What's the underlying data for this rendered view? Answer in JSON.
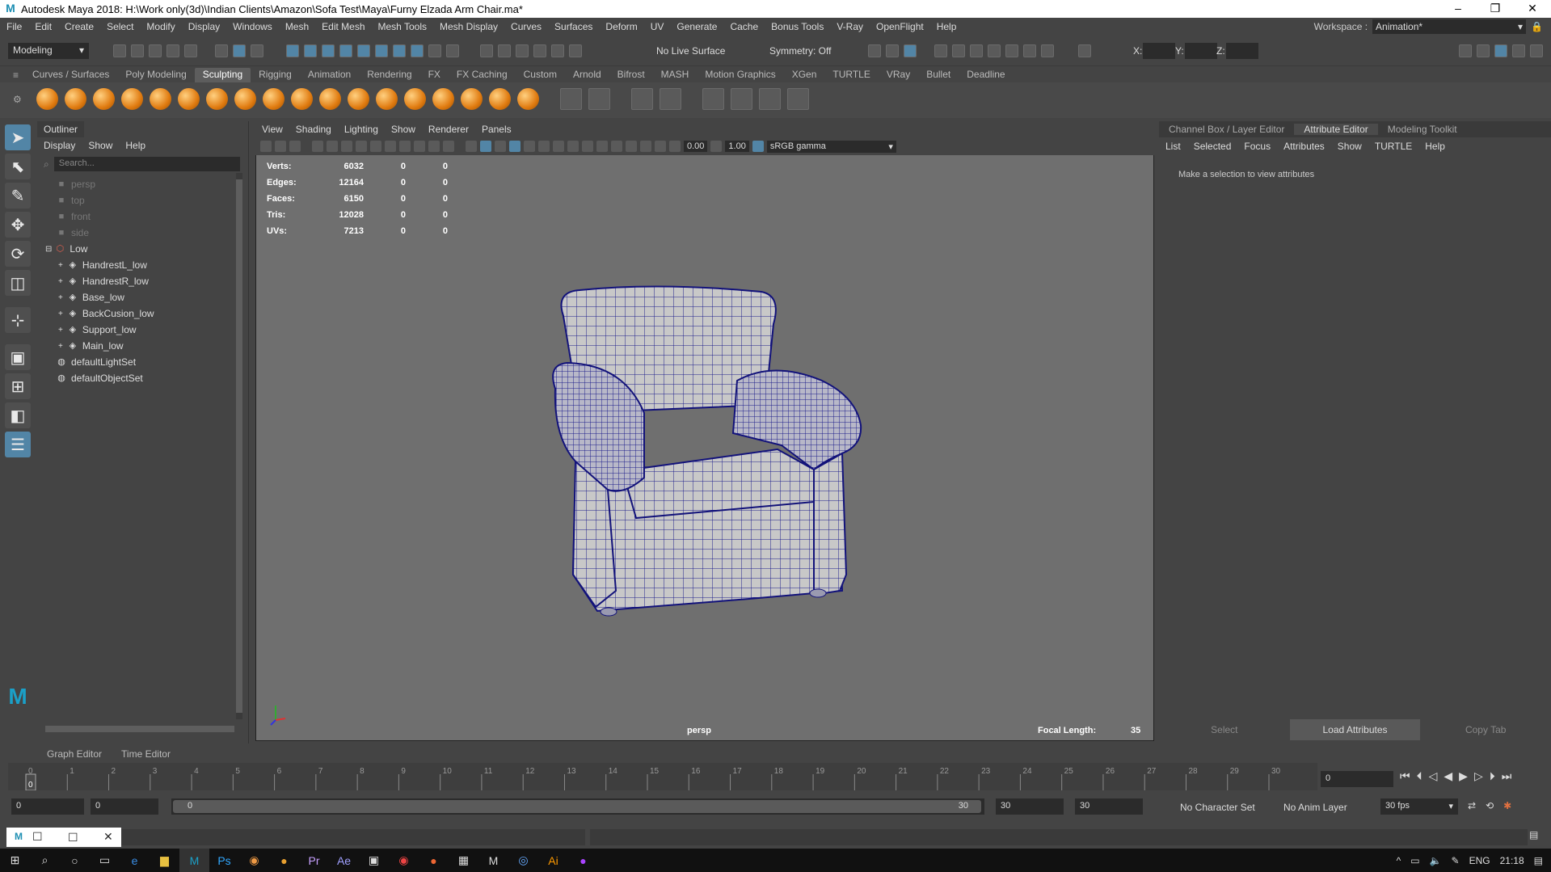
{
  "window": {
    "title": "Autodesk Maya 2018: H:\\Work only(3d)\\Indian Clients\\Amazon\\Sofa Test\\Maya\\Furny Elzada Arm Chair.ma*",
    "logo": "M"
  },
  "menu": [
    "File",
    "Edit",
    "Create",
    "Select",
    "Modify",
    "Display",
    "Windows",
    "Mesh",
    "Edit Mesh",
    "Mesh Tools",
    "Mesh Display",
    "Curves",
    "Surfaces",
    "Deform",
    "UV",
    "Generate",
    "Cache",
    "Bonus Tools",
    "V-Ray",
    "OpenFlight",
    "Help"
  ],
  "workspace": {
    "label": "Workspace :",
    "value": "Animation*"
  },
  "status": {
    "mode": "Modeling",
    "live_surface": "No Live Surface",
    "symmetry": "Symmetry: Off",
    "x_label": "X:",
    "y_label": "Y:",
    "z_label": "Z:"
  },
  "shelf_tabs": [
    "Curves / Surfaces",
    "Poly Modeling",
    "Sculpting",
    "Rigging",
    "Animation",
    "Rendering",
    "FX",
    "FX Caching",
    "Custom",
    "Arnold",
    "Bifrost",
    "MASH",
    "Motion Graphics",
    "XGen",
    "TURTLE",
    "VRay",
    "Bullet",
    "Deadline"
  ],
  "shelf_active": "Sculpting",
  "outliner": {
    "title": "Outliner",
    "menu": [
      "Display",
      "Show",
      "Help"
    ],
    "search_placeholder": "Search...",
    "items": [
      {
        "label": "persp",
        "dim": true,
        "indent": 0,
        "icon": "camera-icon"
      },
      {
        "label": "top",
        "dim": true,
        "indent": 0,
        "icon": "camera-icon"
      },
      {
        "label": "front",
        "dim": true,
        "indent": 0,
        "icon": "camera-icon"
      },
      {
        "label": "side",
        "dim": true,
        "indent": 0,
        "icon": "camera-icon"
      },
      {
        "label": "Low",
        "dim": false,
        "indent": 0,
        "icon": "group-icon"
      },
      {
        "label": "HandrestL_low",
        "dim": false,
        "indent": 1,
        "icon": "mesh-icon"
      },
      {
        "label": "HandrestR_low",
        "dim": false,
        "indent": 1,
        "icon": "mesh-icon"
      },
      {
        "label": "Base_low",
        "dim": false,
        "indent": 1,
        "icon": "mesh-icon"
      },
      {
        "label": "BackCusion_low",
        "dim": false,
        "indent": 1,
        "icon": "mesh-icon"
      },
      {
        "label": "Support_low",
        "dim": false,
        "indent": 1,
        "icon": "mesh-icon"
      },
      {
        "label": "Main_low",
        "dim": false,
        "indent": 1,
        "icon": "mesh-icon"
      },
      {
        "label": "defaultLightSet",
        "dim": false,
        "indent": 0,
        "icon": "set-icon"
      },
      {
        "label": "defaultObjectSet",
        "dim": false,
        "indent": 0,
        "icon": "set-icon"
      }
    ]
  },
  "viewport": {
    "menu": [
      "View",
      "Shading",
      "Lighting",
      "Show",
      "Renderer",
      "Panels"
    ],
    "exposure": "0.00",
    "gamma": "1.00",
    "colorspace": "sRGB gamma",
    "camera": "persp",
    "focal_label": "Focal Length:",
    "focal_value": "35",
    "hud": [
      {
        "label": "Verts:",
        "a": "6032",
        "b": "0",
        "c": "0"
      },
      {
        "label": "Edges:",
        "a": "12164",
        "b": "0",
        "c": "0"
      },
      {
        "label": "Faces:",
        "a": "6150",
        "b": "0",
        "c": "0"
      },
      {
        "label": "Tris:",
        "a": "12028",
        "b": "0",
        "c": "0"
      },
      {
        "label": "UVs:",
        "a": "7213",
        "b": "0",
        "c": "0"
      }
    ]
  },
  "right_panel": {
    "tabs": [
      "Channel Box / Layer Editor",
      "Attribute Editor",
      "Modeling Toolkit"
    ],
    "active": "Attribute Editor",
    "menu": [
      "List",
      "Selected",
      "Focus",
      "Attributes",
      "Show",
      "TURTLE",
      "Help"
    ],
    "message": "Make a selection to view attributes",
    "buttons": [
      "Select",
      "Load Attributes",
      "Copy Tab"
    ]
  },
  "bottom_tabs": [
    "Graph Editor",
    "Time Editor"
  ],
  "timeline": {
    "ticks": [
      "0",
      "1",
      "2",
      "3",
      "4",
      "5",
      "6",
      "7",
      "8",
      "9",
      "10",
      "11",
      "12",
      "13",
      "14",
      "15",
      "16",
      "17",
      "18",
      "19",
      "20",
      "21",
      "22",
      "23",
      "24",
      "25",
      "26",
      "27",
      "28",
      "29",
      "30"
    ],
    "current_frame": "0",
    "current_field": "0"
  },
  "range": {
    "start": "0",
    "anim_start": "0",
    "slider_start": "0",
    "slider_end": "30",
    "end": "30",
    "anim_end": "30",
    "char_set": "No Character Set",
    "anim_layer": "No Anim Layer",
    "fps": "30 fps"
  },
  "taskbar": {
    "lang": "ENG",
    "time": "21:18"
  }
}
